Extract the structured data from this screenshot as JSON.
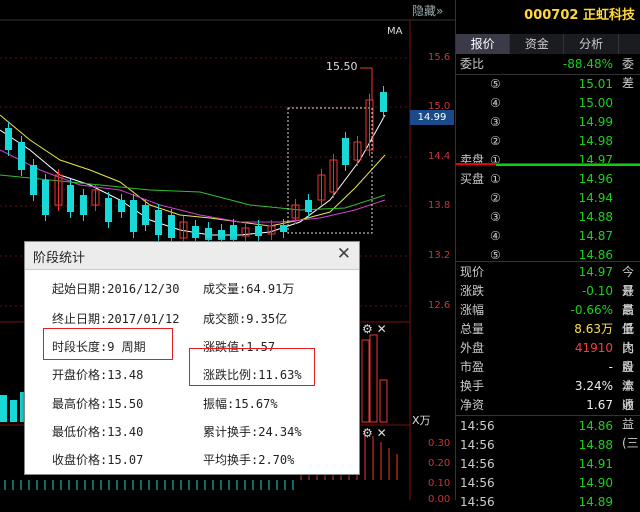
{
  "chart": {
    "hide_label": "隐藏",
    "hide_chevron": "»",
    "ma_label": "MA",
    "y_ticks": [
      "15.6",
      "15.0",
      "14.4",
      "13.8",
      "13.2",
      "12.6"
    ],
    "current_price_tag": "14.99",
    "high_label": "15.50",
    "volume_unit": "X万",
    "lower_ticks": [
      "0.30",
      "0.20",
      "0.10",
      "0.00"
    ]
  },
  "panel": {
    "stock_code": "000702",
    "stock_name": "正虹科技",
    "tabs": [
      {
        "label": "报价",
        "active": true
      },
      {
        "label": "资金",
        "active": false
      },
      {
        "label": "分析",
        "active": false
      },
      {
        "label": "",
        "active": false
      }
    ],
    "ratio_label": "委比",
    "ratio_value": "-88.48%",
    "ratio_right": "委差",
    "sell_prefix": "卖盘",
    "buy_prefix": "买盘",
    "order_book": [
      {
        "label": "⑤",
        "price": "15.01"
      },
      {
        "label": "④",
        "price": "15.00"
      },
      {
        "label": "③",
        "price": "14.99"
      },
      {
        "label": "②",
        "price": "14.98"
      },
      {
        "label": "①",
        "price": "14.97"
      },
      {
        "label": "①",
        "price": "14.96"
      },
      {
        "label": "②",
        "price": "14.94"
      },
      {
        "label": "③",
        "price": "14.88"
      },
      {
        "label": "④",
        "price": "14.87"
      },
      {
        "label": "⑤",
        "price": "14.86"
      }
    ],
    "stats": [
      {
        "label": "现价",
        "value": "14.97",
        "color": "green",
        "right": "今开"
      },
      {
        "label": "涨跌",
        "value": "-0.10",
        "color": "green",
        "right": "最高"
      },
      {
        "label": "涨幅",
        "value": "-0.66%",
        "color": "green",
        "right": "最低"
      },
      {
        "label": "总量",
        "value": "8.63万",
        "color": "yellow",
        "right": "量比"
      },
      {
        "label": "外盘",
        "value": "41910",
        "color": "red",
        "right": "内盘"
      },
      {
        "label": "市盈",
        "value": "-",
        "color": "white",
        "right": "股本"
      },
      {
        "label": "换手",
        "value": "3.24%",
        "color": "white",
        "right": "流通"
      },
      {
        "label": "净资",
        "value": "1.67",
        "color": "white",
        "right": "收益(三"
      }
    ],
    "ticks": [
      {
        "time": "14:56",
        "price": "14.86"
      },
      {
        "time": "14:56",
        "price": "14.88"
      },
      {
        "time": "14:56",
        "price": "14.91"
      },
      {
        "time": "14:56",
        "price": "14.90"
      },
      {
        "time": "14:56",
        "price": "14.89"
      }
    ]
  },
  "dialog": {
    "title": "阶段统计",
    "close": "✕",
    "start_date": "起始日期:2016/12/30",
    "end_date": "终止日期:2017/01/12",
    "period": "时段长度:9 周期",
    "open_price": "开盘价格:13.48",
    "high_price": "最高价格:15.50",
    "low_price": "最低价格:13.40",
    "close_price": "收盘价格:15.07",
    "volume": "成交量:64.91万",
    "amount": "成交额:9.35亿",
    "change_value": "涨跌值:1.57",
    "change_pct": "涨跌比例:11.63%",
    "amplitude": "振幅:15.67%",
    "cum_turnover": "累计换手:24.34%",
    "avg_turnover": "平均换手:2.70%"
  }
}
